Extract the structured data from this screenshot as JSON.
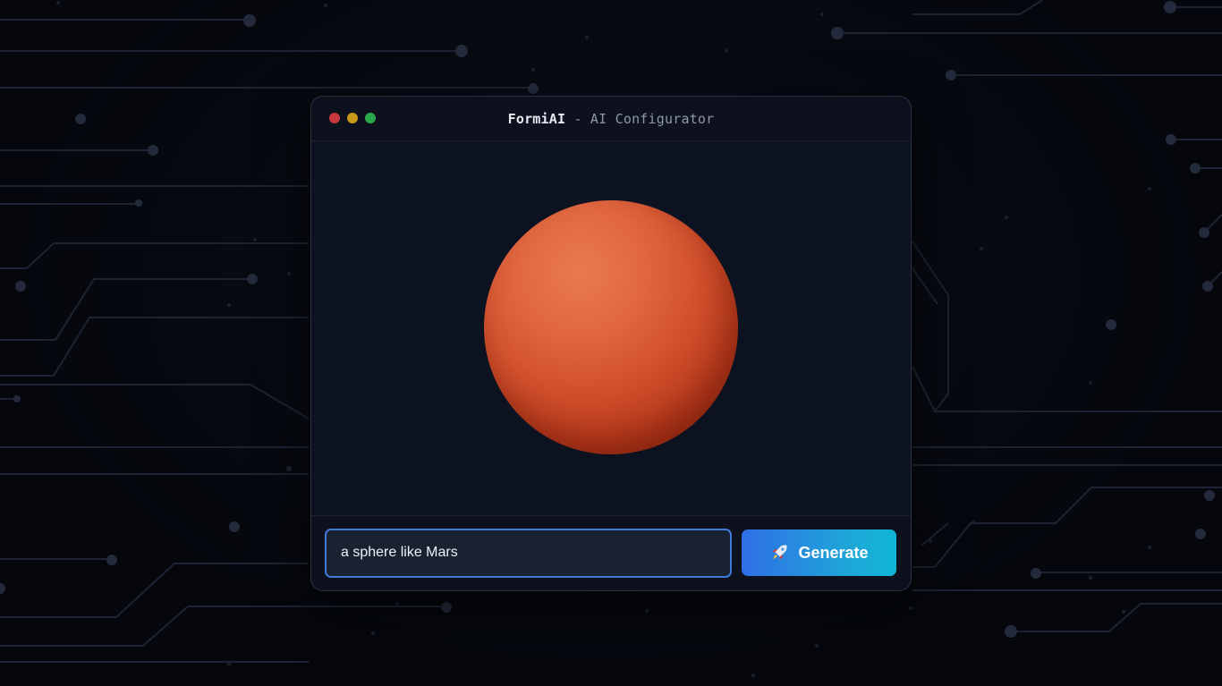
{
  "window": {
    "brand": "FormiAI",
    "subtitle": " - AI Configurator"
  },
  "viewport": {
    "object": "sphere",
    "object_color": "#d1502c"
  },
  "prompt": {
    "value": "a sphere like Mars",
    "placeholder": ""
  },
  "generate_button": {
    "label": "Generate",
    "icon": "rocket-icon"
  },
  "colors": {
    "background": "#05070d",
    "window": "#0c111d",
    "accent_blue": "#2f6fe6",
    "accent_cyan": "#0fb6d6"
  }
}
